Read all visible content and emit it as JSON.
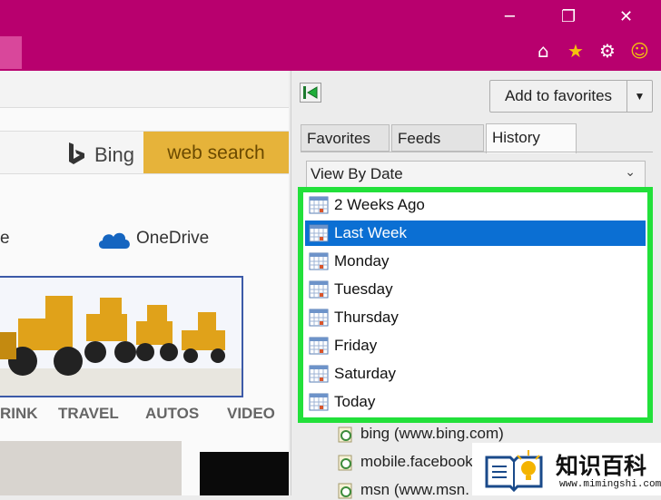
{
  "titlebar": {
    "minimize_glyph": "─",
    "restore_glyph": "❐",
    "close_glyph": "✕",
    "home_glyph": "⌂",
    "favorites_glyph": "★",
    "settings_glyph": "⚙",
    "smiley_glyph": "☺",
    "color": "#b8006e"
  },
  "page": {
    "bing_label": "Bing",
    "web_search_label": "web search",
    "onedrive_label": "OneDrive",
    "partial_left_label": "e",
    "nav": [
      "RINK",
      "TRAVEL",
      "AUTOS",
      "VIDEO"
    ]
  },
  "panel": {
    "add_to_favorites_label": "Add to favorites",
    "dropdown_arrow": "▼",
    "tabs": [
      "Favorites",
      "Feeds",
      "History"
    ],
    "view_by_label": "View By Date",
    "view_by_chevron": "⌄",
    "history_items": [
      "2 Weeks Ago",
      "Last Week",
      "Monday",
      "Tuesday",
      "Thursday",
      "Friday",
      "Saturday",
      "Today"
    ],
    "selected_item": "Last Week",
    "history_entries": [
      "bing (www.bing.com)",
      "mobile.facebook",
      "msn (www.msn."
    ],
    "highlight_color": "#22e03a",
    "selection_color": "#0b6fd3"
  },
  "watermark": {
    "title": "知识百科",
    "url": "www.mimingshi.com"
  }
}
